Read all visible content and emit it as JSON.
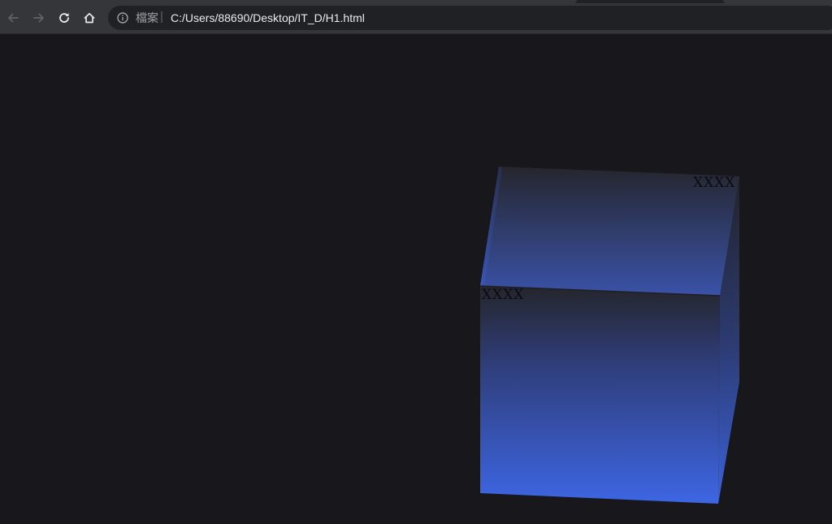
{
  "browser": {
    "address_bar": {
      "security_label": "檔案",
      "separator": "|",
      "url": "C:/Users/88690/Desktop/IT_D/H1.html"
    },
    "icons": {
      "back": "arrow-left-icon",
      "forward": "arrow-right-icon",
      "reload": "reload-icon",
      "home": "home-icon",
      "info": "info-circle-icon"
    }
  },
  "page": {
    "background_color": "#18171c",
    "cube": {
      "top_face_label": "XXXX",
      "front_face_label": "XXXX",
      "gradient_top_color": "#25262d",
      "gradient_bottom_color": "#3d66e4"
    }
  }
}
